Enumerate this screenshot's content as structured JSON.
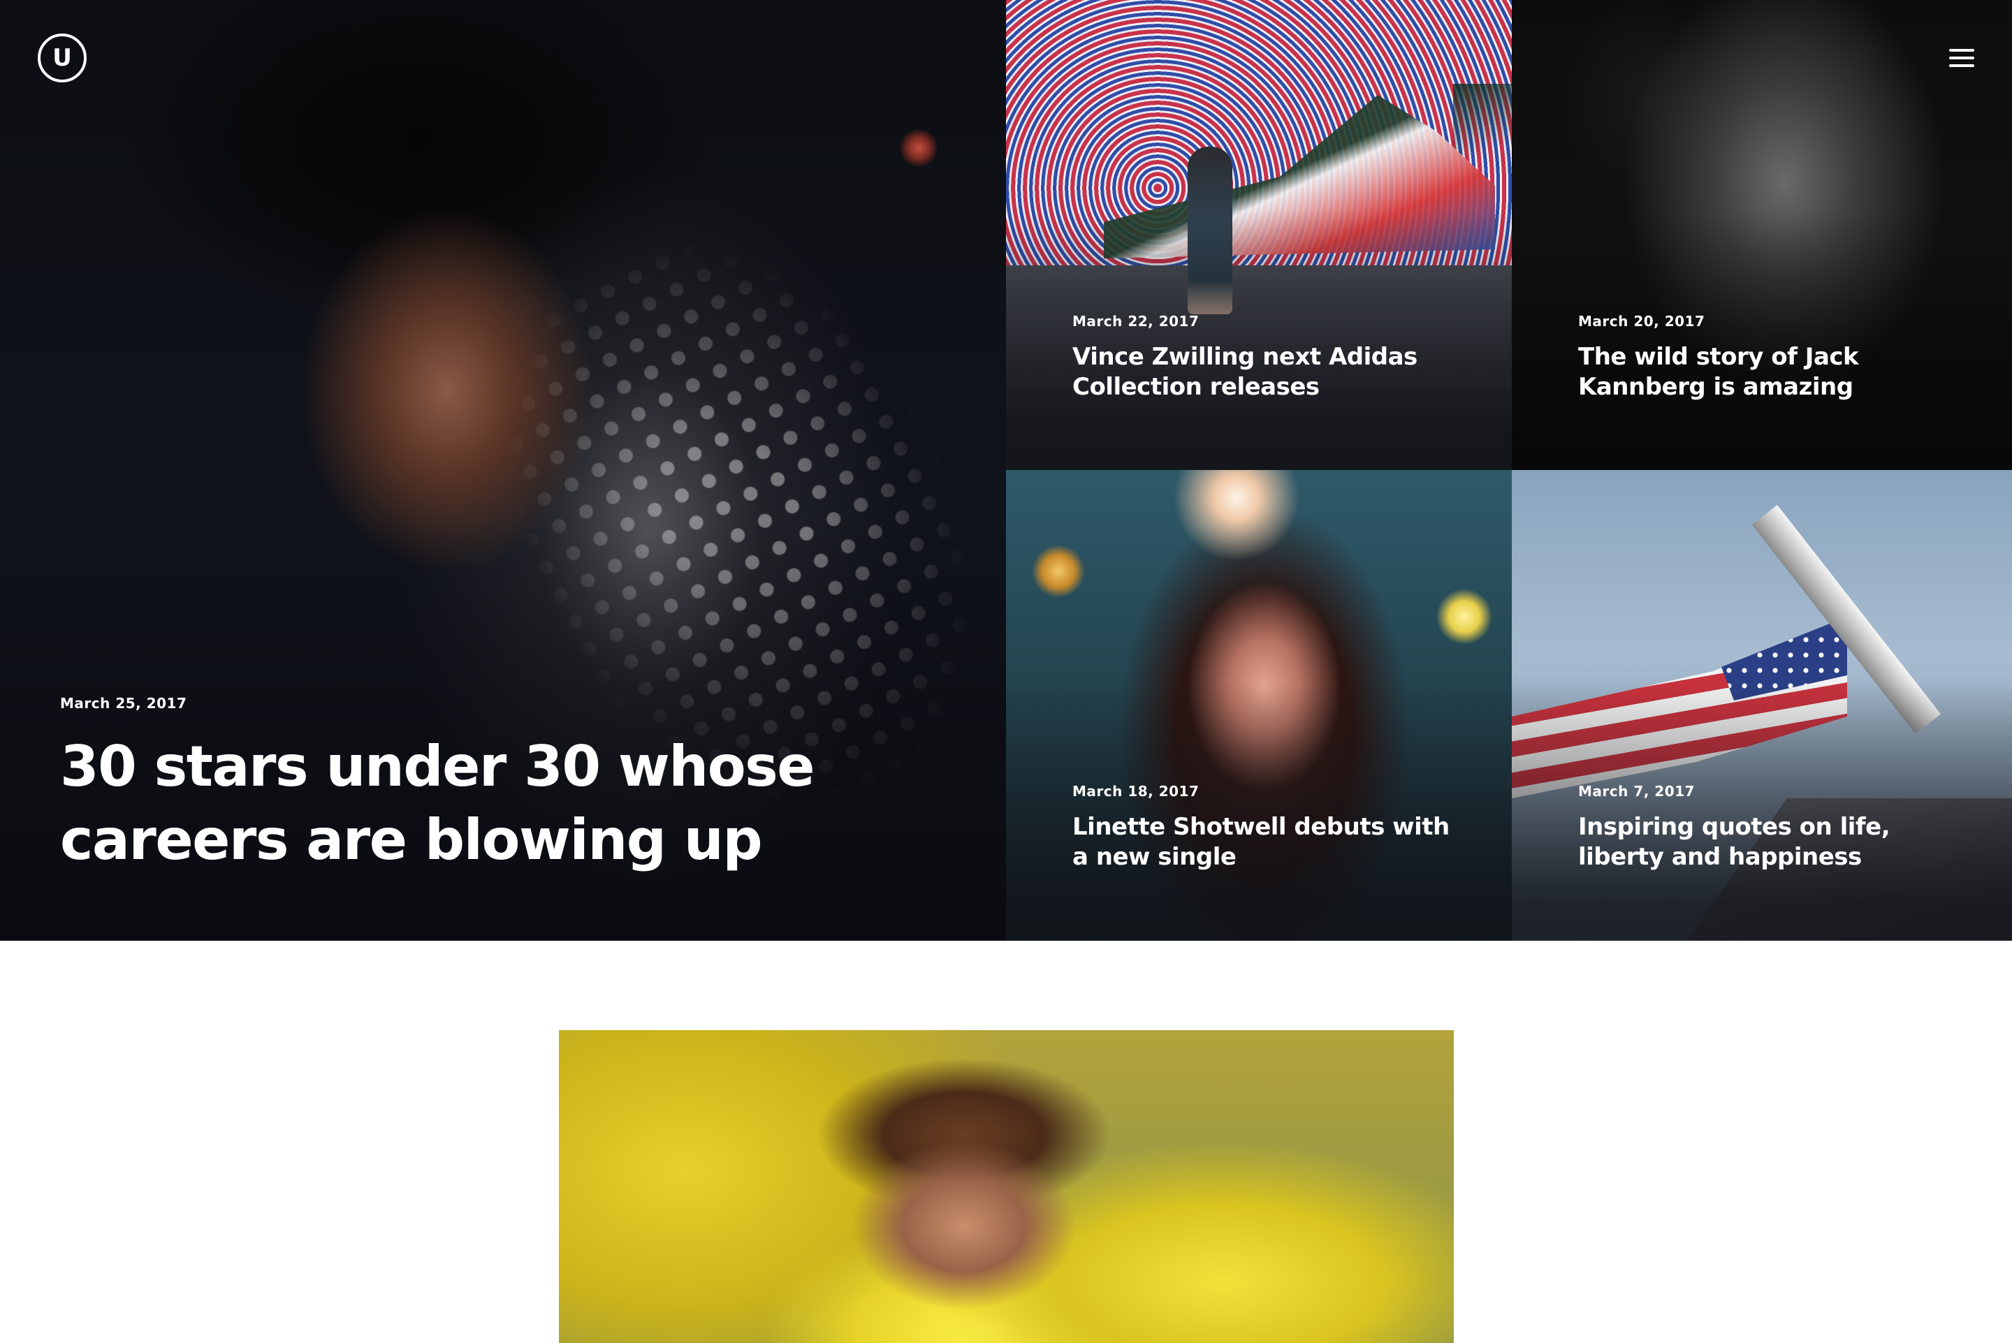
{
  "header": {
    "logo_letter": "U",
    "logo_icon": "u-circle-logo",
    "menu_icon": "hamburger-menu-icon"
  },
  "featured": {
    "date": "March 25, 2017",
    "title": "30 stars under 30 whose careers are blowing up"
  },
  "posts": [
    {
      "date": "March 22, 2017",
      "title": "Vince Zwilling next Adidas Collection releases"
    },
    {
      "date": "March 20, 2017",
      "title": "The wild story of Jack Kannberg is amazing"
    },
    {
      "date": "March 18, 2017",
      "title": "Linette Shotwell debuts with a new single"
    },
    {
      "date": "March 7, 2017",
      "title": "Inspiring quotes on life, liberty and happiness"
    }
  ],
  "colors": {
    "hero_background": "#0b0d12",
    "text_on_image": "#ffffff",
    "page_background": "#ffffff"
  }
}
